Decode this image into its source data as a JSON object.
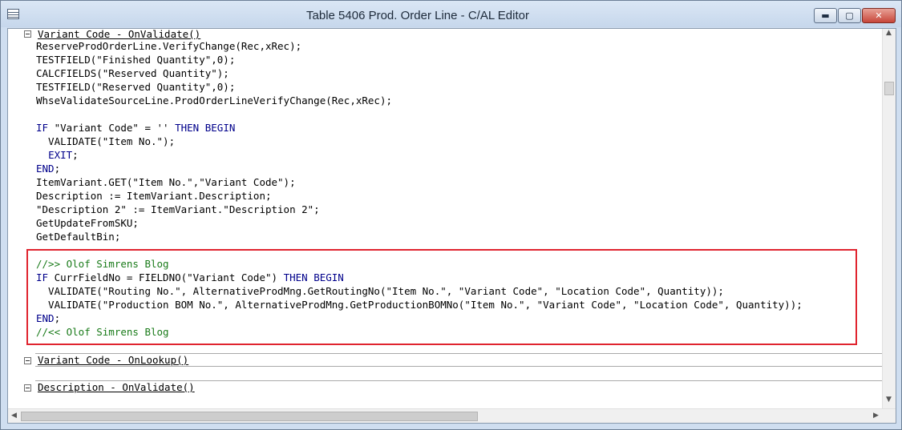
{
  "window": {
    "title": "Table 5406 Prod. Order Line - C/AL Editor",
    "minimize_glyph": "▬",
    "maximize_glyph": "▢",
    "close_glyph": "✕"
  },
  "triggers": [
    {
      "label": "Variant Code - OnValidate()"
    },
    {
      "label": "Variant Code - OnLookup()"
    },
    {
      "label": "Description - OnValidate()"
    }
  ],
  "code_lines": [
    "ReserveProdOrderLine.VerifyChange(Rec,xRec);",
    "TESTFIELD(\"Finished Quantity\",0);",
    "CALCFIELDS(\"Reserved Quantity\");",
    "TESTFIELD(\"Reserved Quantity\",0);",
    "WhseValidateSourceLine.ProdOrderLineVerifyChange(Rec,xRec);",
    "",
    "IF \"Variant Code\" = '' THEN BEGIN",
    "  VALIDATE(\"Item No.\");",
    "  EXIT;",
    "END;",
    "ItemVariant.GET(\"Item No.\",\"Variant Code\");",
    "Description := ItemVariant.Description;",
    "\"Description 2\" := ItemVariant.\"Description 2\";",
    "GetUpdateFromSKU;",
    "GetDefaultBin;",
    "",
    "//>> Olof Simrens Blog",
    "IF CurrFieldNo = FIELDNO(\"Variant Code\") THEN BEGIN",
    "  VALIDATE(\"Routing No.\", AlternativeProdMng.GetRoutingNo(\"Item No.\", \"Variant Code\", \"Location Code\", Quantity));",
    "  VALIDATE(\"Production BOM No.\", AlternativeProdMng.GetProductionBOMNo(\"Item No.\", \"Variant Code\", \"Location Code\", Quantity));",
    "END;",
    "//<< Olof Simrens Blog"
  ],
  "colors": {
    "keyword": "#00008b",
    "comment": "#1a7b1a",
    "highlight_border": "#e0242f"
  }
}
